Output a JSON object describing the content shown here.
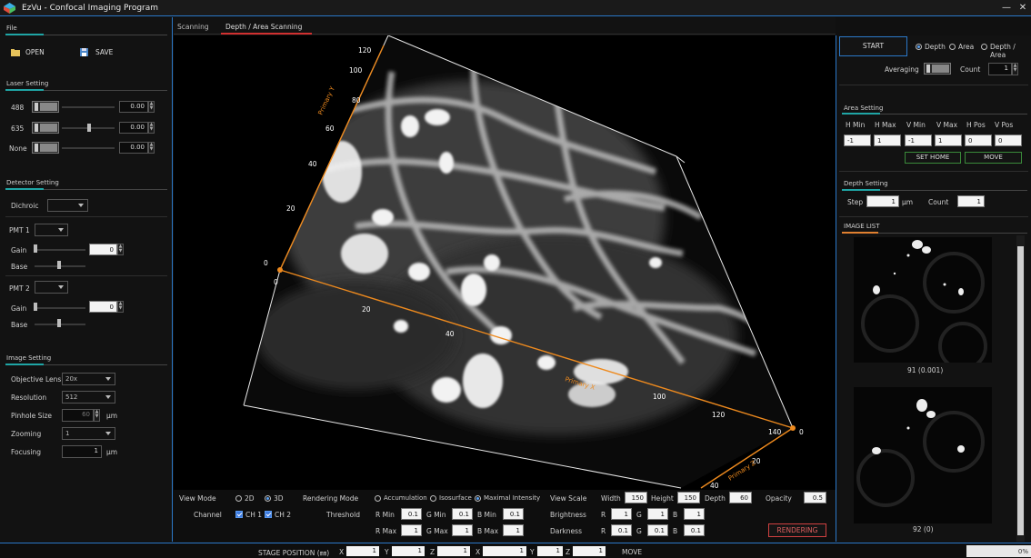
{
  "window": {
    "title": "EzVu - Confocal Imaging Program",
    "minimize": "—",
    "close": "✕"
  },
  "file": {
    "section": "File",
    "open": "OPEN",
    "save": "SAVE"
  },
  "laser": {
    "section": "Laser Setting",
    "rows": [
      {
        "label": "488",
        "value": "0.00"
      },
      {
        "label": "635",
        "value": "0.00"
      },
      {
        "label": "None",
        "value": "0.00"
      }
    ]
  },
  "detector": {
    "section": "Detector Setting",
    "dichroic_label": "Dichroic",
    "pmt1": {
      "label": "PMT 1",
      "gain_label": "Gain",
      "gain_value": "0",
      "base_label": "Base"
    },
    "pmt2": {
      "label": "PMT 2",
      "gain_label": "Gain",
      "gain_value": "0",
      "base_label": "Base"
    }
  },
  "image_setting": {
    "section": "Image Setting",
    "objective_label": "Objective Lens",
    "objective_value": "20x",
    "resolution_label": "Resolution",
    "resolution_value": "512",
    "pinhole_label": "Pinhole Size",
    "pinhole_value": "60",
    "pinhole_unit": "μm",
    "zooming_label": "Zooming",
    "zooming_value": "1",
    "focusing_label": "Focusing",
    "focusing_value": "1",
    "focusing_unit": "μm"
  },
  "tabs": [
    {
      "label": "Scanning"
    },
    {
      "label": "Depth / Area Scanning"
    }
  ],
  "viewport": {
    "axis_y_label": "Primary Y",
    "axis_x_label": "Primary X",
    "axis_z_label": "Primary Z",
    "y_ticks": [
      "120",
      "100",
      "80",
      "60",
      "40",
      "20",
      "0"
    ],
    "x_ticks": [
      "0",
      "20",
      "40",
      "100",
      "120",
      "140"
    ],
    "z_ticks": [
      "0",
      "20",
      "40"
    ]
  },
  "bottom": {
    "view_mode_label": "View Mode",
    "mode_2d": "2D",
    "mode_3d": "3D",
    "rendering_mode_label": "Rendering Mode",
    "accumulation": "Accumulation",
    "isosurface": "Isosurface",
    "maximal": "Maximal Intensity",
    "view_scale_label": "View Scale",
    "width_label": "Width",
    "width_value": "150",
    "height_label": "Height",
    "height_value": "150",
    "depth_label": "Depth",
    "depth_value": "60",
    "opacity_label": "Opacity",
    "opacity_value": "0.5",
    "channel_label": "Channel",
    "ch1": "CH 1",
    "ch2": "CH 2",
    "threshold_label": "Threshold",
    "r_min_label": "R Min",
    "r_min": "0.1",
    "g_min_label": "G Min",
    "g_min": "0.1",
    "b_min_label": "B Min",
    "b_min": "0.1",
    "r_max_label": "R Max",
    "r_max": "1",
    "g_max_label": "G Max",
    "g_max": "1",
    "b_max_label": "B Max",
    "b_max": "1",
    "brightness_label": "Brightness",
    "darkness_label": "Darkness",
    "r_label": "R",
    "g_label": "G",
    "b_label": "B",
    "br_r": "1",
    "br_g": "1",
    "br_b": "1",
    "dk_r": "0.1",
    "dk_g": "0.1",
    "dk_b": "0.1",
    "render_button": "RENDERING"
  },
  "scan": {
    "start": "START",
    "depth": "Depth",
    "area": "Area",
    "depth_area": "Depth / Area",
    "averaging_label": "Averaging",
    "count_label": "Count",
    "count_value": "1"
  },
  "area": {
    "section": "Area Setting",
    "headers": [
      "H Min",
      "H Max",
      "V Min",
      "V Max",
      "H Pos",
      "V Pos"
    ],
    "values": [
      "-1",
      "1",
      "-1",
      "1",
      "0",
      "0"
    ],
    "set_home": "SET HOME",
    "move": "MOVE"
  },
  "depth": {
    "section": "Depth Setting",
    "step_label": "Step",
    "step_value": "1",
    "step_unit": "μm",
    "count_label": "Count",
    "count_value": "1"
  },
  "image_list": {
    "section": "IMAGE LIST",
    "items": [
      {
        "caption": "91 (0.001)"
      },
      {
        "caption": "92 (0)"
      }
    ]
  },
  "status": {
    "label": "STAGE POSITION (㎜)",
    "fields": [
      {
        "axis": "X",
        "value": "1"
      },
      {
        "axis": "Y",
        "value": "1"
      },
      {
        "axis": "Z",
        "value": "1"
      },
      {
        "axis": "X",
        "value": "1"
      },
      {
        "axis": "Y",
        "value": "1"
      },
      {
        "axis": "Z",
        "value": "1"
      }
    ],
    "move": "MOVE",
    "progress_text": "0%",
    "progress": 0
  }
}
